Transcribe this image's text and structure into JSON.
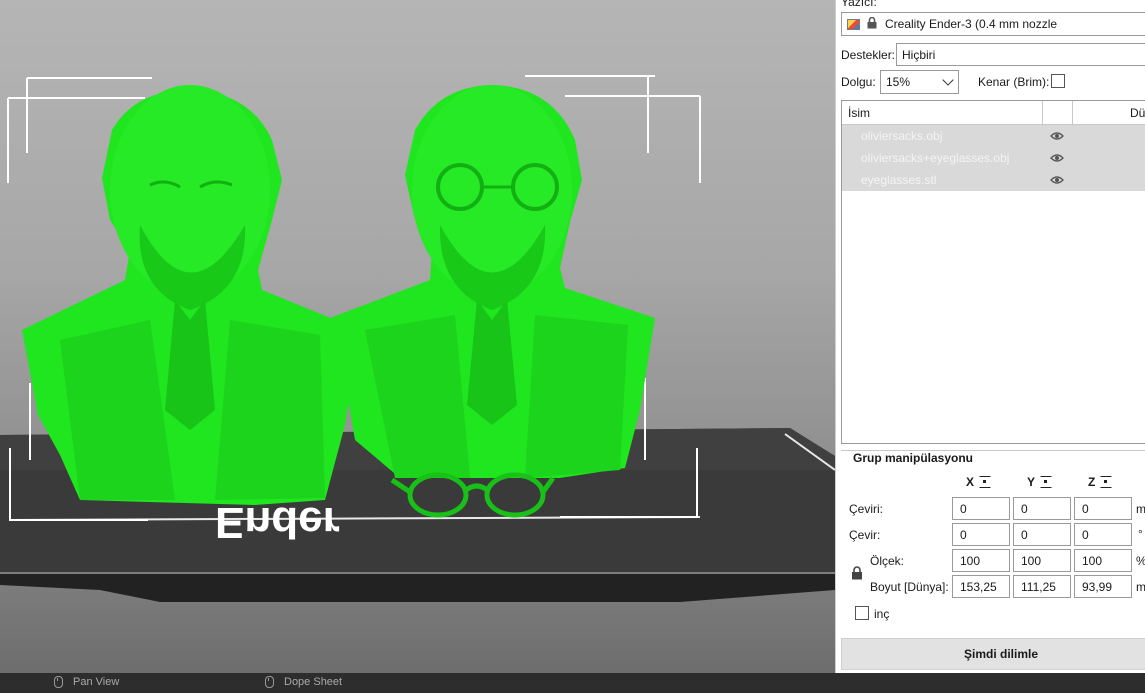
{
  "printer": {
    "label": "Yazıcı:",
    "name": "Creality Ender-3 (0.4 mm nozzle"
  },
  "supports": {
    "label": "Destekler:",
    "value": "Hiçbiri"
  },
  "infill": {
    "label": "Dolgu:",
    "value": "15%"
  },
  "brim": {
    "label": "Kenar (Brim):",
    "checked": false
  },
  "objects_table": {
    "headers": [
      "İsim",
      "Düz"
    ],
    "rows": [
      {
        "name": "oliviersacks.obj",
        "icon": "eye-icon"
      },
      {
        "name": "oliviersacks+eyeglasses.obj",
        "icon": "eye-icon"
      },
      {
        "name": "eyeglasses.stl",
        "icon": "eye-icon"
      }
    ]
  },
  "group": {
    "title": "Grup manipülasyonu",
    "axes": [
      "X",
      "Y",
      "Z"
    ],
    "translate": {
      "label": "Çeviri:",
      "values": [
        "0",
        "0",
        "0"
      ],
      "unit": "m"
    },
    "rotate": {
      "label": "Çevir:",
      "values": [
        "0",
        "0",
        "0"
      ],
      "unit": "°"
    },
    "scale": {
      "label": "Ölçek:",
      "values": [
        "100",
        "100",
        "100"
      ],
      "unit": "%"
    },
    "size": {
      "label": "Boyut [Dünya]:",
      "values": [
        "153,25",
        "111,25",
        "93,99"
      ],
      "unit": "m"
    },
    "inch": {
      "label": "inç",
      "checked": false
    }
  },
  "slice_button": "Şimdi dilimle",
  "taskbar": {
    "items": [
      "Pan View",
      "Dope Sheet"
    ]
  },
  "viewport": {
    "bed_text": "Ender",
    "model_color": "#1fe61f",
    "bed_color": "#333333"
  }
}
